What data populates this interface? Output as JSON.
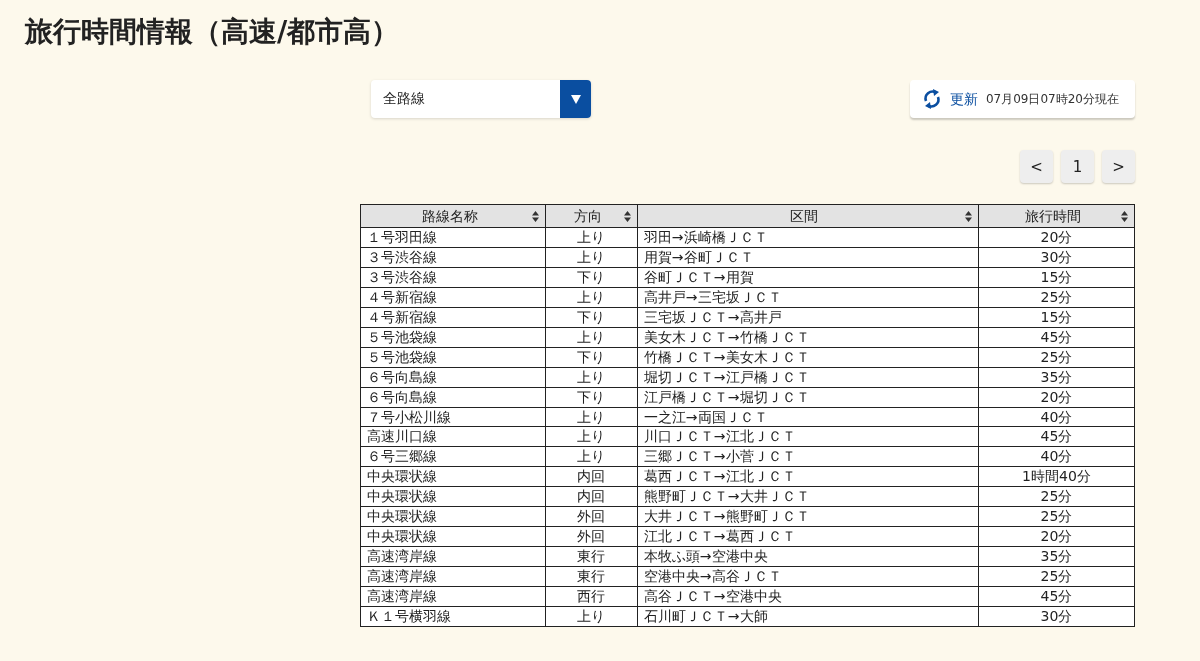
{
  "page_title": "旅行時間情報（高速/都市高）",
  "route_select": {
    "value": "全路線"
  },
  "refresh": {
    "label": "更新",
    "timestamp": "07月09日07時20分現在"
  },
  "pagination": {
    "prev": "<",
    "pages": [
      "1"
    ],
    "next": ">"
  },
  "table": {
    "columns": [
      "路線名称",
      "方向",
      "区間",
      "旅行時間"
    ],
    "rows": [
      [
        "１号羽田線",
        "上り",
        "羽田→浜崎橋ＪＣＴ",
        "20分"
      ],
      [
        "３号渋谷線",
        "上り",
        "用賀→谷町ＪＣＴ",
        "30分"
      ],
      [
        "３号渋谷線",
        "下り",
        "谷町ＪＣＴ→用賀",
        "15分"
      ],
      [
        "４号新宿線",
        "上り",
        "高井戸→三宅坂ＪＣＴ",
        "25分"
      ],
      [
        "４号新宿線",
        "下り",
        "三宅坂ＪＣＴ→高井戸",
        "15分"
      ],
      [
        "５号池袋線",
        "上り",
        "美女木ＪＣＴ→竹橋ＪＣＴ",
        "45分"
      ],
      [
        "５号池袋線",
        "下り",
        "竹橋ＪＣＴ→美女木ＪＣＴ",
        "25分"
      ],
      [
        "６号向島線",
        "上り",
        "堀切ＪＣＴ→江戸橋ＪＣＴ",
        "35分"
      ],
      [
        "６号向島線",
        "下り",
        "江戸橋ＪＣＴ→堀切ＪＣＴ",
        "20分"
      ],
      [
        "７号小松川線",
        "上り",
        "一之江→両国ＪＣＴ",
        "40分"
      ],
      [
        "高速川口線",
        "上り",
        "川口ＪＣＴ→江北ＪＣＴ",
        "45分"
      ],
      [
        "６号三郷線",
        "上り",
        "三郷ＪＣＴ→小菅ＪＣＴ",
        "40分"
      ],
      [
        "中央環状線",
        "内回",
        "葛西ＪＣＴ→江北ＪＣＴ",
        "1時間40分"
      ],
      [
        "中央環状線",
        "内回",
        "熊野町ＪＣＴ→大井ＪＣＴ",
        "25分"
      ],
      [
        "中央環状線",
        "外回",
        "大井ＪＣＴ→熊野町ＪＣＴ",
        "25分"
      ],
      [
        "中央環状線",
        "外回",
        "江北ＪＣＴ→葛西ＪＣＴ",
        "20分"
      ],
      [
        "高速湾岸線",
        "東行",
        "本牧ふ頭→空港中央",
        "35分"
      ],
      [
        "高速湾岸線",
        "東行",
        "空港中央→高谷ＪＣＴ",
        "25分"
      ],
      [
        "高速湾岸線",
        "西行",
        "高谷ＪＣＴ→空港中央",
        "45分"
      ],
      [
        "Ｋ１号横羽線",
        "上り",
        "石川町ＪＣＴ→大師",
        "30分"
      ]
    ]
  }
}
